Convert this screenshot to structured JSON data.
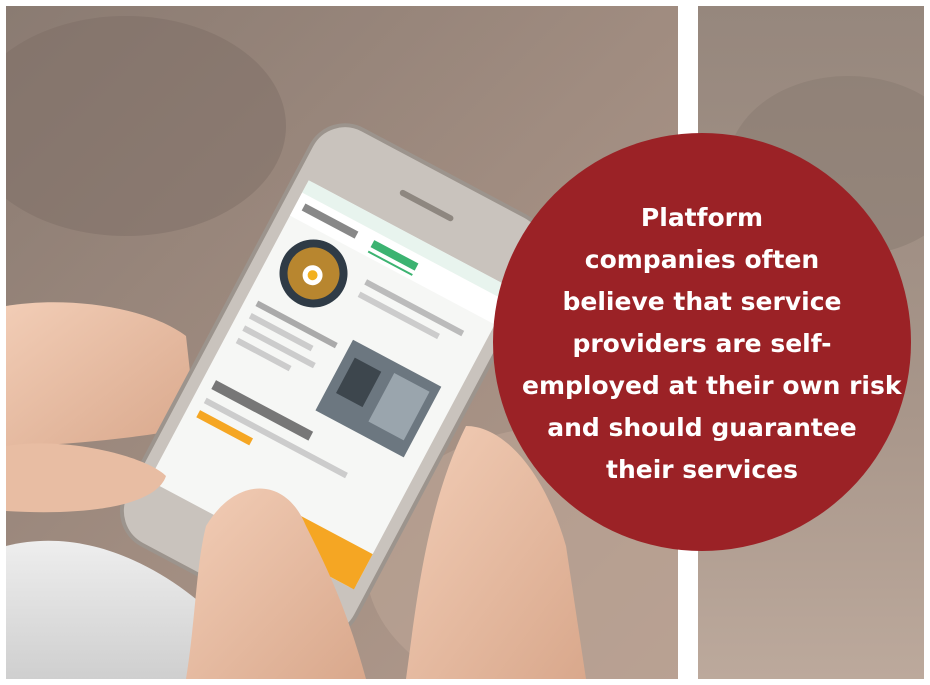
{
  "quote": {
    "lines": [
      "Platform",
      "companies often",
      "believe that service",
      "providers are self-",
      "employed at their own risk",
      "and should guarantee",
      "their services"
    ],
    "background_color": "#9b2226",
    "text_color": "#ffffff"
  },
  "photo": {
    "subject-icon": "hand-holding-smartphone-icon",
    "accent_color": "#f5a623",
    "screen_accent_color": "#3cb371"
  }
}
